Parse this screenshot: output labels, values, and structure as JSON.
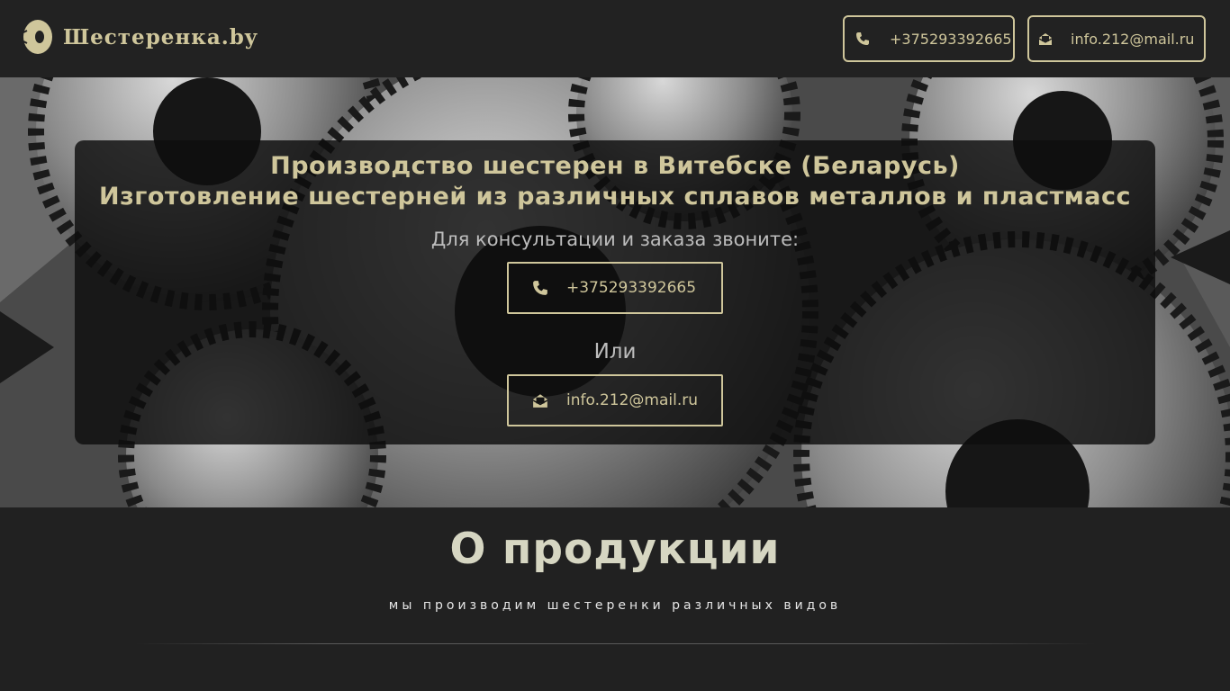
{
  "header": {
    "logo_text": "Шестеренка.by",
    "phone": "+375293392665",
    "email": "info.212@mail.ru",
    "icons": {
      "phone": "phone-icon",
      "email": "envelope-open-icon",
      "logo": "gear-logo-icon"
    }
  },
  "hero": {
    "title_line1": "Производство шестерен в Витебске (Беларусь)",
    "title_line2": "Изготовление шестерней из различных сплавов металлов и пластмасс",
    "consult_text": "Для консультации и заказа звоните:",
    "phone": "+375293392665",
    "or_text": "Или",
    "email": "info.212@mail.ru"
  },
  "about": {
    "title": "О продукции",
    "subtitle": "мы производим шестеренки различных видов"
  },
  "colors": {
    "accent": "#cfc69b",
    "background": "#212121"
  }
}
